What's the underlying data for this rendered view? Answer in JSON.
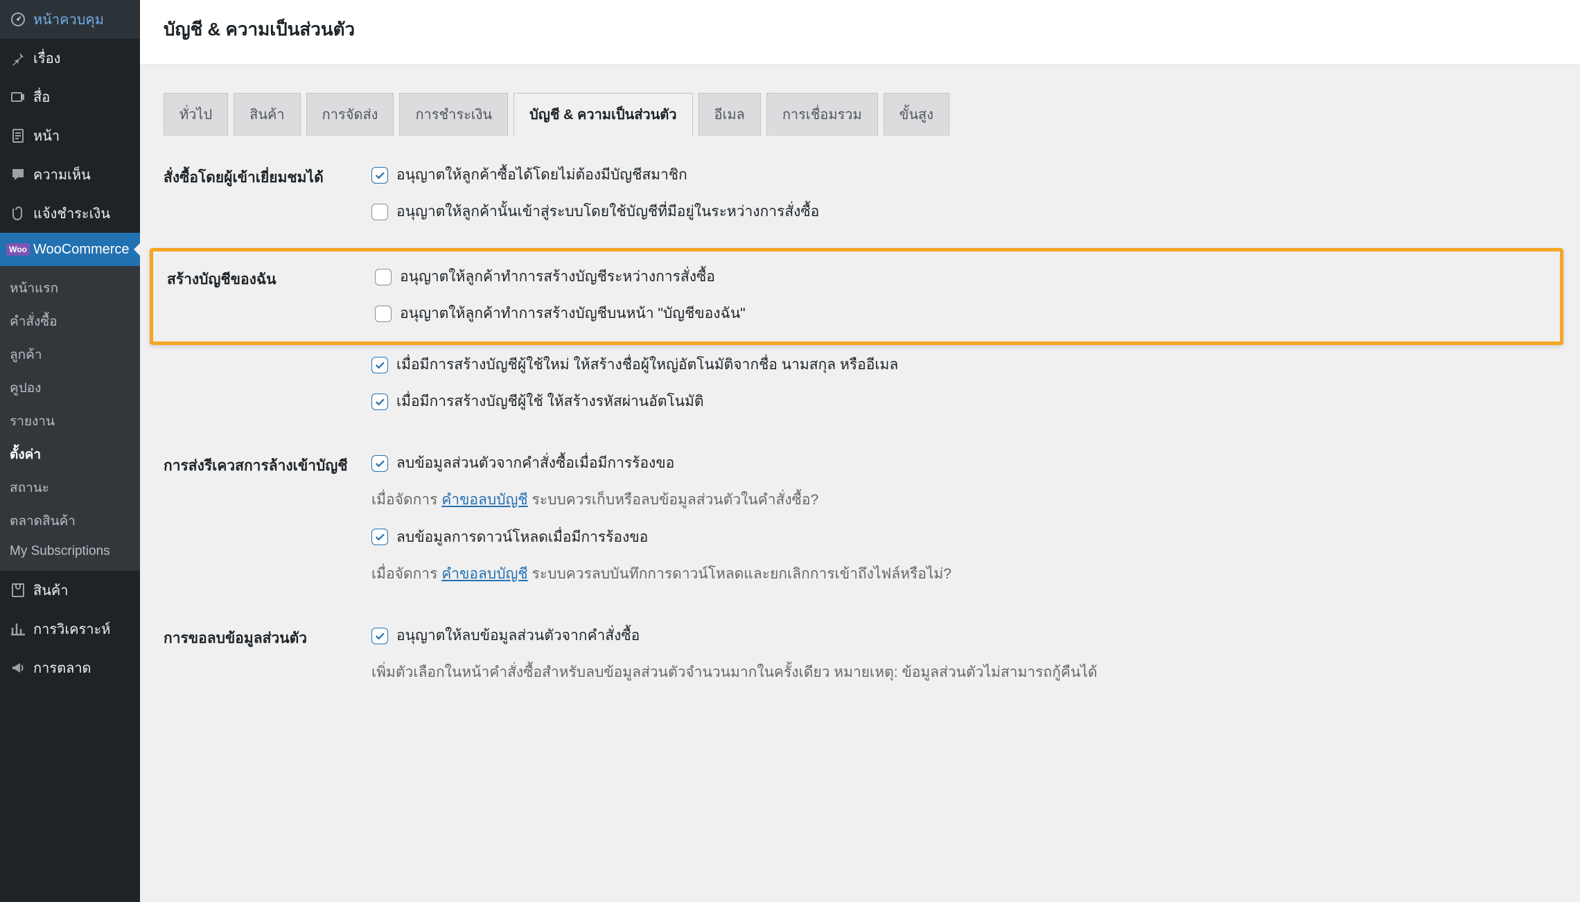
{
  "sidebar": {
    "items": [
      {
        "icon": "dashboard",
        "label": "หน้าควบคุม"
      },
      {
        "icon": "pin",
        "label": "เรื่อง"
      },
      {
        "icon": "media",
        "label": "สื่อ"
      },
      {
        "icon": "page",
        "label": "หน้า"
      },
      {
        "icon": "comment",
        "label": "ความเห็น"
      },
      {
        "icon": "clip",
        "label": "แจ้งชำระเงิน"
      },
      {
        "icon": "woo",
        "label": "WooCommerce"
      },
      {
        "icon": "product",
        "label": "สินค้า"
      },
      {
        "icon": "analytics",
        "label": "การวิเคราะห์"
      },
      {
        "icon": "marketing",
        "label": "การตลาด"
      }
    ],
    "submenu": [
      "หน้าแรก",
      "คำสั่งซื้อ",
      "ลูกค้า",
      "คูปอง",
      "รายงาน",
      "ตั้งค่า",
      "สถานะ",
      "ตลาดสินค้า",
      "My Subscriptions"
    ],
    "submenu_current": "ตั้งค่า"
  },
  "page": {
    "title": "บัญชี & ความเป็นส่วนตัว"
  },
  "tabs": [
    "ทั่วไป",
    "สินค้า",
    "การจัดส่ง",
    "การชำระเงิน",
    "บัญชี & ความเป็นส่วนตัว",
    "อีเมล",
    "การเชื่อมรวม",
    "ขั้นสูง"
  ],
  "tab_active": "บัญชี & ความเป็นส่วนตัว",
  "sections": {
    "guest_checkout": {
      "label": "สั่งซื้อโดยผู้เข้าเยี่ยมชมได้",
      "opts": [
        {
          "checked": true,
          "text": "อนุญาตให้ลูกค้าซื้อได้โดยไม่ต้องมีบัญชีสมาชิก"
        },
        {
          "checked": false,
          "text": "อนุญาตให้ลูกค้านั้นเข้าสู่ระบบโดยใช้บัญชีที่มีอยู่ในระหว่างการสั่งซื้อ"
        }
      ]
    },
    "account_creation": {
      "label": "สร้างบัญชีของฉัน",
      "highlighted": [
        {
          "checked": false,
          "text": "อนุญาตให้ลูกค้าทำการสร้างบัญชีระหว่างการสั่งซื้อ"
        },
        {
          "checked": false,
          "text": "อนุญาตให้ลูกค้าทำการสร้างบัญชีบนหน้า \"บัญชีของฉัน\""
        }
      ],
      "rest": [
        {
          "checked": true,
          "text": "เมื่อมีการสร้างบัญชีผู้ใช้ใหม่ ให้สร้างชื่อผู้ใหญ่อัตโนมัติจากชื่อ นามสกุล หรืออีเมล"
        },
        {
          "checked": true,
          "text": "เมื่อมีการสร้างบัญชีผู้ใช้ ให้สร้างรหัสผ่านอัตโนมัติ"
        }
      ]
    },
    "erasure": {
      "label": "การส่งรีเควสการล้างเข้าบัญชี",
      "opts": [
        {
          "checked": true,
          "text": "ลบข้อมูลส่วนตัวจากคำสั่งซื้อเมื่อมีการร้องขอ"
        }
      ],
      "help1_pre": "เมื่อจัดการ ",
      "help1_link": "คำขอลบบัญชี",
      "help1_post": " ระบบควรเก็บหรือลบข้อมูลส่วนตัวในคำสั่งซื้อ?",
      "opts2": [
        {
          "checked": true,
          "text": "ลบข้อมูลการดาวน์โหลดเมื่อมีการร้องขอ"
        }
      ],
      "help2_pre": "เมื่อจัดการ ",
      "help2_link": "คำขอลบบัญชี",
      "help2_post": " ระบบควรลบบันทึกการดาวน์โหลดและยกเลิกการเข้าถึงไฟล์หรือไม่?"
    },
    "data_removal": {
      "label": "การขอลบข้อมูลส่วนตัว",
      "opts": [
        {
          "checked": true,
          "text": "อนุญาตให้ลบข้อมูลส่วนตัวจากคำสั่งซื้อ"
        }
      ],
      "help": "เพิ่มตัวเลือกในหน้าคำสั่งซื้อสำหรับลบข้อมูลส่วนตัวจำนวนมากในครั้งเดียว หมายเหตุ: ข้อมูลส่วนตัวไม่สามารถกู้คืนได้"
    }
  }
}
